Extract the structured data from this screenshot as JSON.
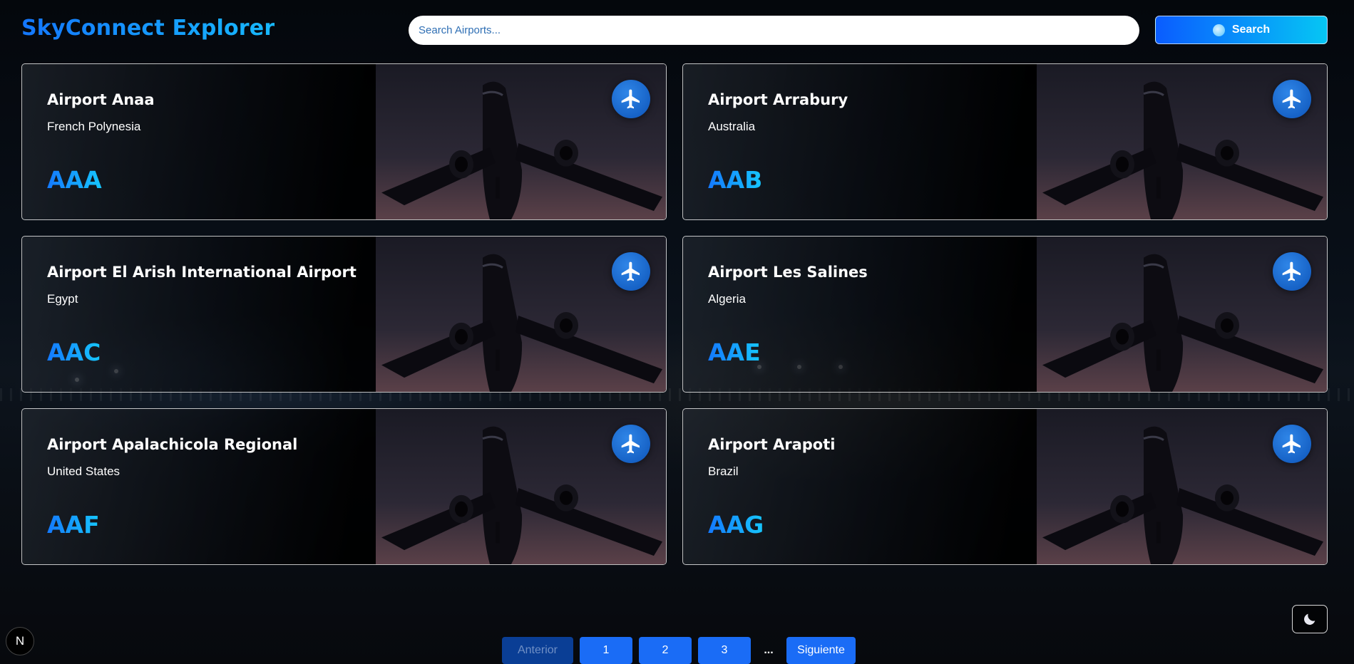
{
  "app": {
    "title": "SkyConnect Explorer"
  },
  "search": {
    "placeholder": "Search Airports...",
    "value": "",
    "button_label": "Search"
  },
  "airports": [
    {
      "name": "Airport Anaa",
      "country": "French Polynesia",
      "code": "AAA"
    },
    {
      "name": "Airport Arrabury",
      "country": "Australia",
      "code": "AAB"
    },
    {
      "name": "Airport El Arish International Airport",
      "country": "Egypt",
      "code": "AAC"
    },
    {
      "name": "Airport Les Salines",
      "country": "Algeria",
      "code": "AAE"
    },
    {
      "name": "Airport Apalachicola Regional",
      "country": "United States",
      "code": "AAF"
    },
    {
      "name": "Airport Arapoti",
      "country": "Brazil",
      "code": "AAG"
    }
  ],
  "pagination": {
    "prev_label": "Anterior",
    "pages": [
      "1",
      "2",
      "3"
    ],
    "ellipsis": "...",
    "next_label": "Siguiente"
  },
  "theme": {
    "mode": "dark",
    "toggle_icon": "moon-icon"
  },
  "dev_badge": {
    "letter": "N"
  },
  "colors": {
    "accent_gradient_start": "#1477ff",
    "accent_gradient_end": "#16c7ff",
    "badge_blue": "#1560c4",
    "page_button": "#1a6cf6"
  }
}
